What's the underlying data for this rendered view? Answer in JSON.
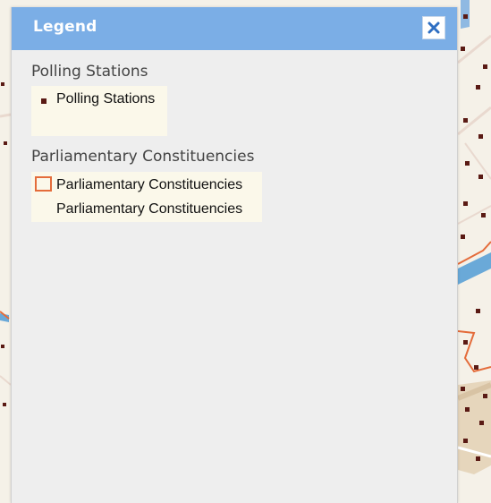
{
  "legend": {
    "title": "Legend",
    "close_icon": "close-icon",
    "sections": [
      {
        "title": "Polling Stations",
        "items": [
          {
            "label": "Polling Stations",
            "symbol": "square-dot",
            "color": "#5a1a14"
          }
        ]
      },
      {
        "title": "Parliamentary Constituencies",
        "items": [
          {
            "label": "Parliamentary Constituencies",
            "symbol": "outlined-square",
            "color": "#e46c3b"
          },
          {
            "label": "Parliamentary Constituencies",
            "symbol": "none"
          }
        ]
      }
    ]
  },
  "colors": {
    "header": "#7baee6",
    "panel": "#eeeeee",
    "legend_box": "#fbf8ea",
    "map_background": "#f5f1e8",
    "boundary": "#e46c3b",
    "river": "#6aa9d8",
    "point": "#5a1a14"
  }
}
